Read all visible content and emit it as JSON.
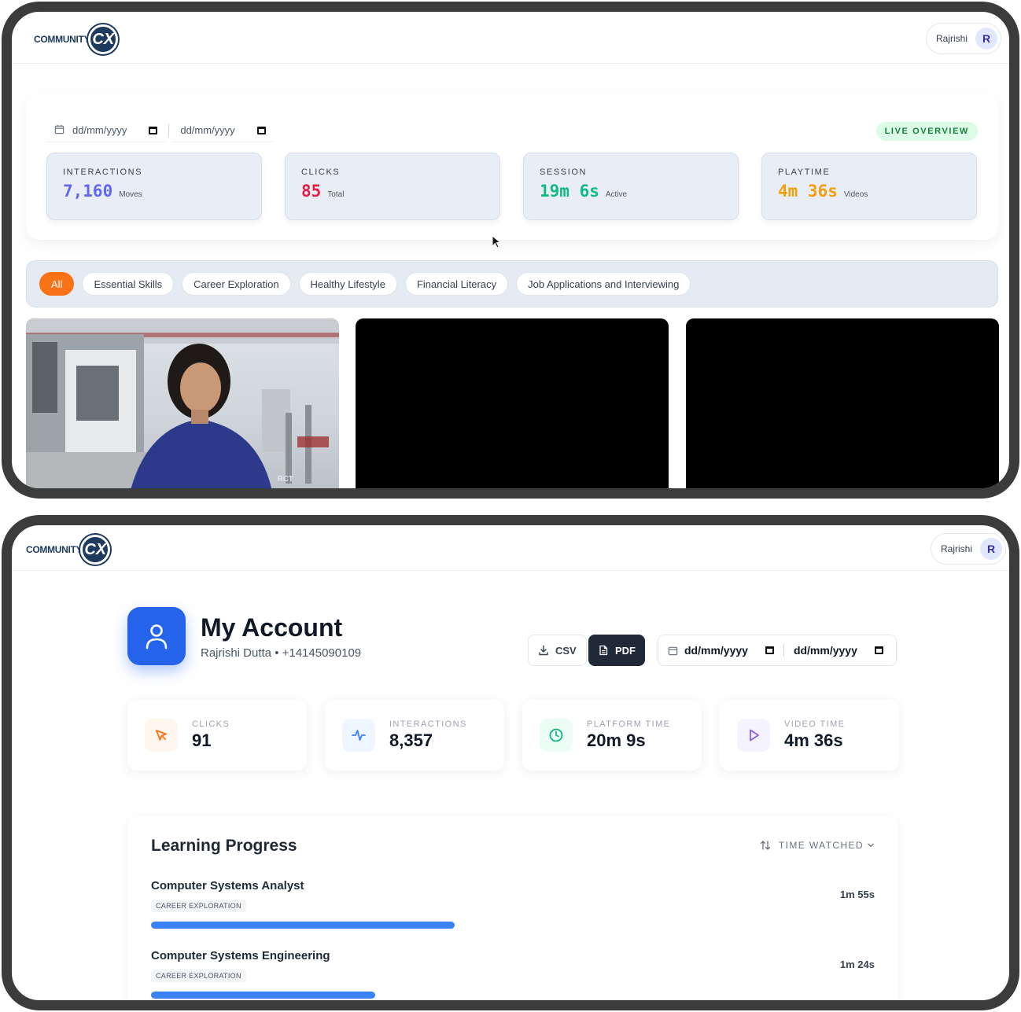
{
  "dashboard": {
    "logo_text": "COMMUNITY",
    "logo_mark": "CX",
    "user": {
      "name": "Rajrishi",
      "initial": "R"
    },
    "date_from_placeholder": "dd/mm/yyyy",
    "date_to_placeholder": "dd/mm/yyyy",
    "live_badge": "LIVE OVERVIEW",
    "stats": [
      {
        "label": "INTERACTIONS",
        "value": "7,160",
        "unit": "Moves",
        "color": "#6366f1"
      },
      {
        "label": "CLICKS",
        "value": "85",
        "unit": "Total",
        "color": "#e11d48"
      },
      {
        "label": "SESSION",
        "value": "19m 6s",
        "unit": "Active",
        "color": "#10b981"
      },
      {
        "label": "PLAYTIME",
        "value": "4m 36s",
        "unit": "Videos",
        "color": "#f59e0b"
      }
    ],
    "filters": [
      "All",
      "Essential Skills",
      "Career Exploration",
      "Healthy Lifestyle",
      "Financial Literacy",
      "Job Applications and Interviewing"
    ],
    "active_filter": "All",
    "video_watermark": "RCT"
  },
  "account": {
    "logo_text": "COMMUNITY",
    "logo_mark": "CX",
    "user": {
      "name": "Rajrishi",
      "initial": "R"
    },
    "title": "My Account",
    "subtitle": "Rajrishi Dutta • +14145090109",
    "csv_label": "CSV",
    "pdf_label": "PDF",
    "date_from": "dd/mm/yyyy",
    "date_to": "dd/mm/yyyy",
    "kpis": [
      {
        "label": "CLICKS",
        "value": "91",
        "icon": "cursor-icon",
        "color": "#f97316"
      },
      {
        "label": "INTERACTIONS",
        "value": "8,357",
        "icon": "activity-icon",
        "color": "#3b82f6"
      },
      {
        "label": "PLATFORM TIME",
        "value": "20m 9s",
        "icon": "clock-icon",
        "color": "#10b981"
      },
      {
        "label": "VIDEO TIME",
        "value": "4m 36s",
        "icon": "play-icon",
        "color": "#8b5cf6"
      }
    ],
    "progress": {
      "title": "Learning Progress",
      "sort_label": "TIME WATCHED",
      "courses": [
        {
          "name": "Computer Systems Analyst",
          "tag": "CAREER EXPLORATION",
          "time": "1m 55s",
          "fraction": 0.42
        },
        {
          "name": "Computer Systems Engineering",
          "tag": "CAREER EXPLORATION",
          "time": "1m 24s",
          "fraction": 0.31
        }
      ]
    }
  }
}
